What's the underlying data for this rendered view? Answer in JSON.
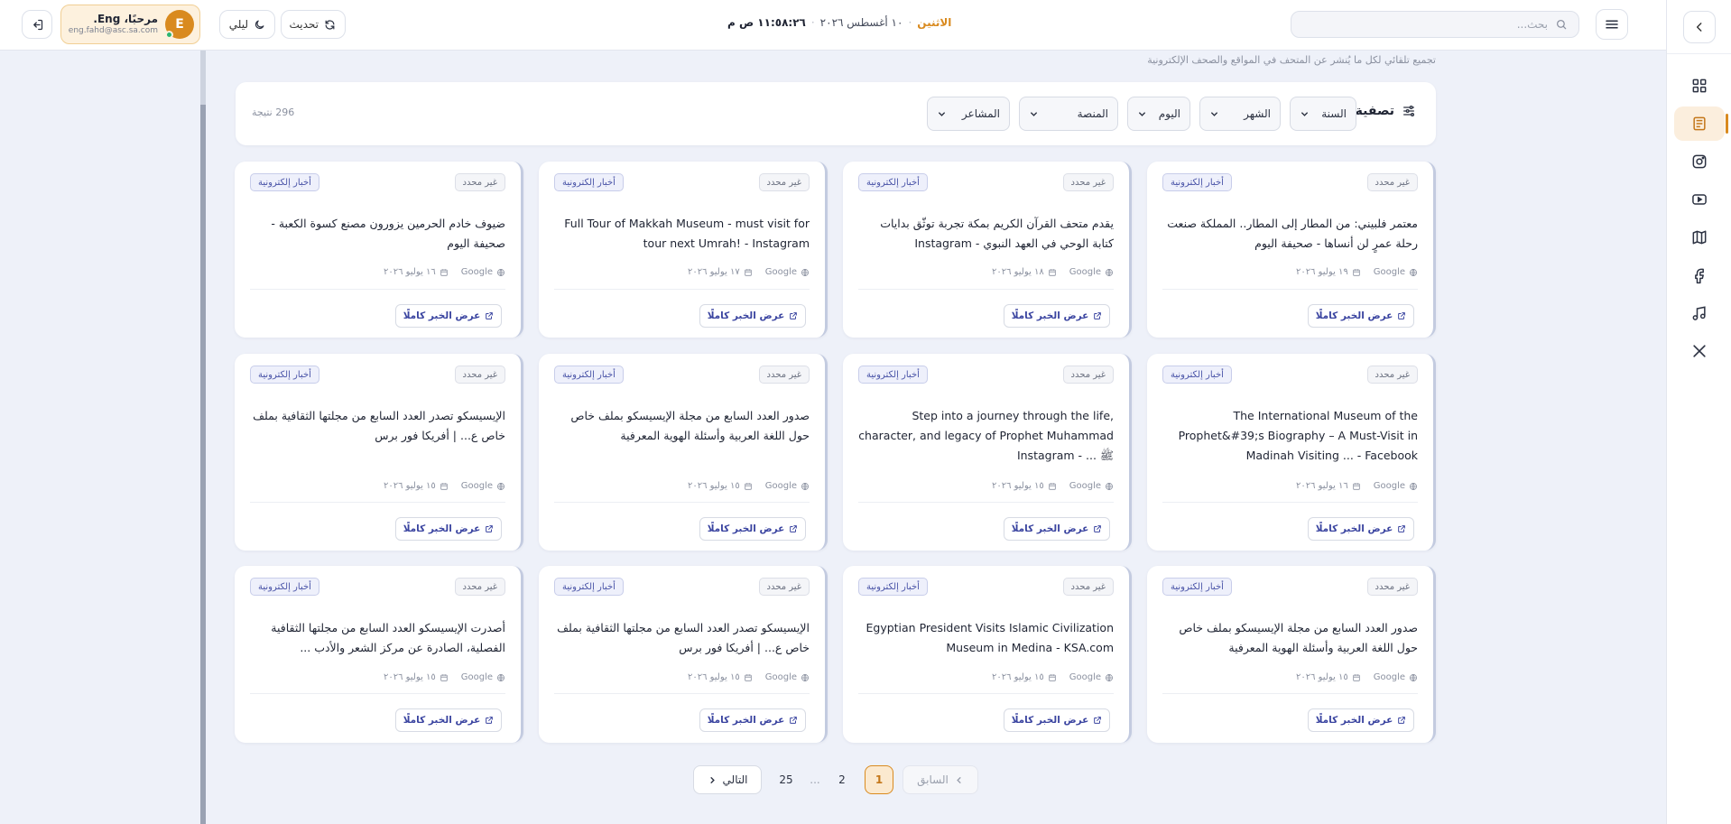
{
  "header": {
    "search_placeholder": "بحث...",
    "day": "الاثنين",
    "date": "١٠ أغسطس ٢٠٢٦",
    "time": "١١:٥٨:٢٦ ص م",
    "refresh_label": "تحديث",
    "night_label": "ليلي",
    "user": {
      "initial": "E",
      "greeting": "مرحبًا، Eng.",
      "email": "eng.fahd@asc.sa.com"
    }
  },
  "sidebar": {
    "icons": [
      "grid-icon",
      "newspaper-icon",
      "instagram-icon",
      "youtube-icon",
      "map-icon",
      "facebook-icon",
      "tiktok-icon",
      "x-icon"
    ],
    "active_index": 1
  },
  "page": {
    "subtitle": "تجميع تلقائي لكل ما يُنشر عن المتحف في المواقع والصحف الإلكترونية"
  },
  "filters": {
    "label": "تصفية",
    "year": "السنة",
    "month": "الشهر",
    "day": "اليوم",
    "platform": "المنصة",
    "sentiment": "المشاعر",
    "results": "296 نتيجة"
  },
  "cards": [
    {
      "type": "أخبار إلكترونية",
      "status": "غير محدد",
      "title": "معتمر فلبيني: من المطار إلى المطار.. المملكة صنعت رحلة عمرٍ لن أنساها - صحيفة اليوم",
      "source": "Google",
      "date": "١٩ يوليو ٢٠٢٦",
      "button": "عرض الخبر كاملًا"
    },
    {
      "type": "أخبار إلكترونية",
      "status": "غير محدد",
      "title": "يقدم متحف القرآن الكريم بمكة تجربة توثّق بدايات كتابة الوحي في العهد النبوي - Instagram",
      "source": "Google",
      "date": "١٨ يوليو ٢٠٢٦",
      "button": "عرض الخبر كاملًا"
    },
    {
      "type": "أخبار إلكترونية",
      "status": "غير محدد",
      "title": "Full Tour of Makkah Museum - must visit for tour next Umrah! - Instagram",
      "source": "Google",
      "date": "١٧ يوليو ٢٠٢٦",
      "button": "عرض الخبر كاملًا"
    },
    {
      "type": "أخبار إلكترونية",
      "status": "غير محدد",
      "title": "ضيوف خادم الحرمين يزورون مصنع كسوة الكعبة - صحيفة اليوم",
      "source": "Google",
      "date": "١٦ يوليو ٢٠٢٦",
      "button": "عرض الخبر كاملًا"
    },
    {
      "type": "أخبار إلكترونية",
      "status": "غير محدد",
      "title": "The International Museum of the Prophet&#39;s Biography – A Must-Visit in Madinah Visiting ... - Facebook",
      "source": "Google",
      "date": "١٦ يوليو ٢٠٢٦",
      "button": "عرض الخبر كاملًا"
    },
    {
      "type": "أخبار إلكترونية",
      "status": "غير محدد",
      "title": "Step into a journey through the life, character, and legacy of Prophet Muhammad ﷺ ... - Instagram",
      "source": "Google",
      "date": "١٥ يوليو ٢٠٢٦",
      "button": "عرض الخبر كاملًا"
    },
    {
      "type": "أخبار إلكترونية",
      "status": "غير محدد",
      "title": "صدور العدد السابع من مجلة الإيسيسكو بملف خاص حول اللغة العربية وأسئلة الهوية المعرفية",
      "source": "Google",
      "date": "١٥ يوليو ٢٠٢٦",
      "button": "عرض الخبر كاملًا"
    },
    {
      "type": "أخبار إلكترونية",
      "status": "غير محدد",
      "title": "الإيسيسكو تصدر العدد السابع من مجلتها الثقافية بملف خاص ع... | أفريكا فور برس",
      "source": "Google",
      "date": "١٥ يوليو ٢٠٢٦",
      "button": "عرض الخبر كاملًا"
    },
    {
      "type": "أخبار إلكترونية",
      "status": "غير محدد",
      "title": "صدور العدد السابع من مجلة الإيسيسكو بملف خاص حول اللغة العربية وأسئلة الهوية المعرفية",
      "source": "Google",
      "date": "١٥ يوليو ٢٠٢٦",
      "button": "عرض الخبر كاملًا"
    },
    {
      "type": "أخبار إلكترونية",
      "status": "غير محدد",
      "title": "Egyptian President Visits Islamic Civilization Museum in Medina - KSA.com",
      "source": "Google",
      "date": "١٥ يوليو ٢٠٢٦",
      "button": "عرض الخبر كاملًا"
    },
    {
      "type": "أخبار إلكترونية",
      "status": "غير محدد",
      "title": "الإيسيسكو تصدر العدد السابع من مجلتها الثقافية بملف خاص ع... | أفريكا فور برس",
      "source": "Google",
      "date": "١٥ يوليو ٢٠٢٦",
      "button": "عرض الخبر كاملًا"
    },
    {
      "type": "أخبار إلكترونية",
      "status": "غير محدد",
      "title": "أصدرت الإيسيسكو العدد السابع من مجلتها الثقافية الفصلية، الصادرة عن مركز الشعر والأدب ...",
      "source": "Google",
      "date": "١٥ يوليو ٢٠٢٦",
      "button": "عرض الخبر كاملًا"
    }
  ],
  "pagination": {
    "prev": "السابق",
    "next": "التالي",
    "pages": [
      "1",
      "2",
      "...",
      "25"
    ],
    "current": "1"
  }
}
